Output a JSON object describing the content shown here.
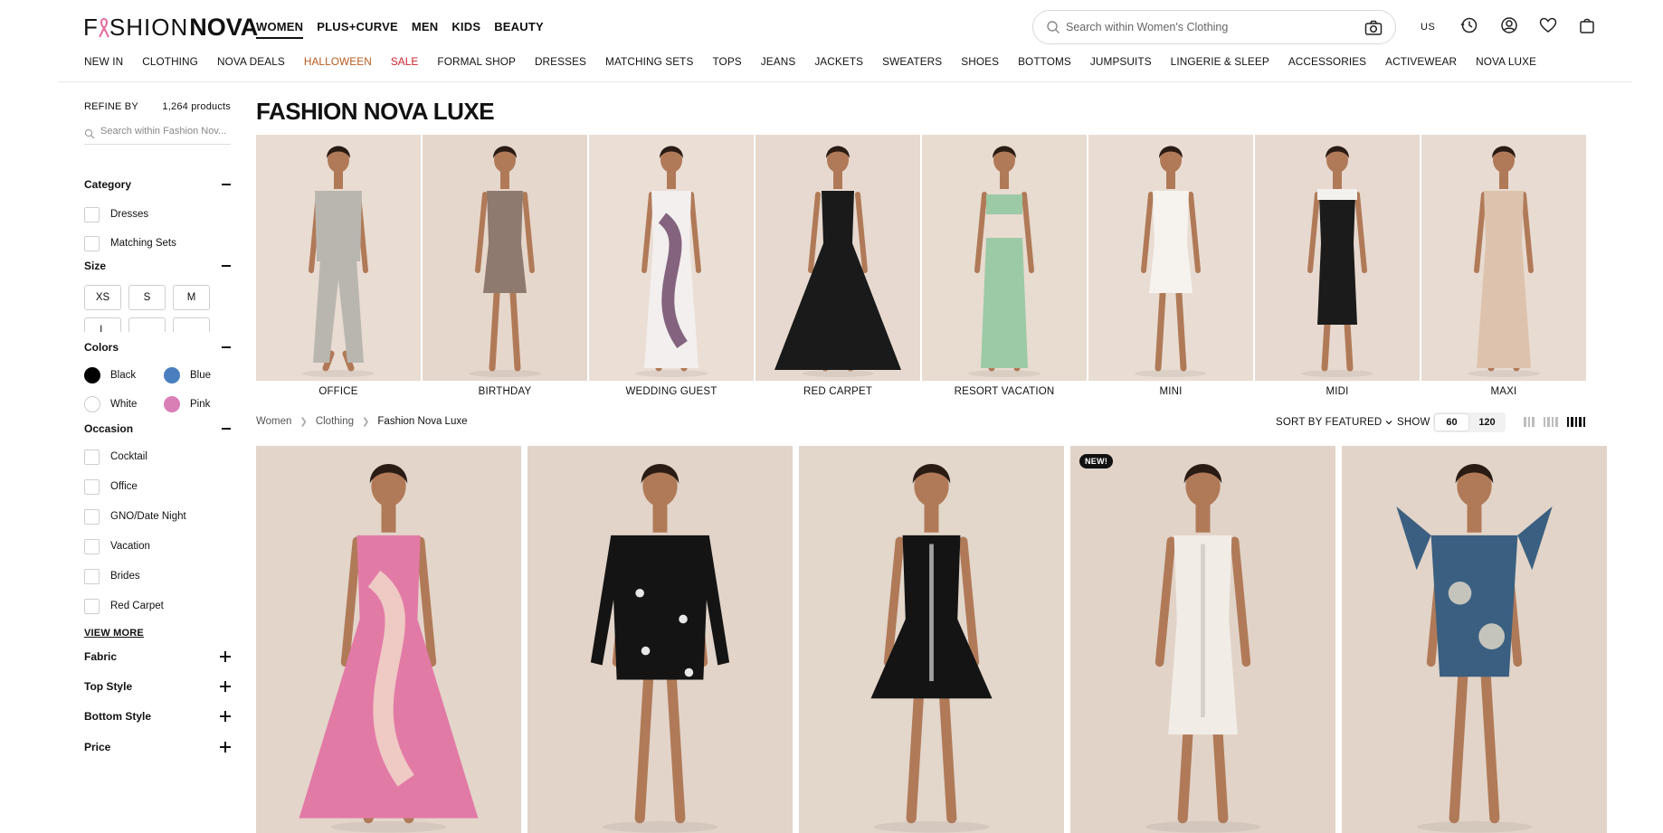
{
  "brand": {
    "name_part1": "F",
    "name_part2": "SHION",
    "name_part3": "NOVA"
  },
  "segments": [
    "WOMEN",
    "PLUS+CURVE",
    "MEN",
    "KIDS",
    "BEAUTY"
  ],
  "search": {
    "placeholder": "Search within Women's Clothing"
  },
  "region": "US",
  "nav": [
    {
      "label": "NEW IN",
      "color": "#111111"
    },
    {
      "label": "CLOTHING",
      "color": "#111111"
    },
    {
      "label": "NOVA DEALS",
      "color": "#111111"
    },
    {
      "label": "HALLOWEEN",
      "color": "#b65a1d"
    },
    {
      "label": "SALE",
      "color": "#d0222d"
    },
    {
      "label": "FORMAL SHOP",
      "color": "#111111"
    },
    {
      "label": "DRESSES",
      "color": "#111111"
    },
    {
      "label": "MATCHING SETS",
      "color": "#111111"
    },
    {
      "label": "TOPS",
      "color": "#111111"
    },
    {
      "label": "JEANS",
      "color": "#111111"
    },
    {
      "label": "JACKETS",
      "color": "#111111"
    },
    {
      "label": "SWEATERS",
      "color": "#111111"
    },
    {
      "label": "SHOES",
      "color": "#111111"
    },
    {
      "label": "BOTTOMS",
      "color": "#111111"
    },
    {
      "label": "JUMPSUITS",
      "color": "#111111"
    },
    {
      "label": "LINGERIE & SLEEP",
      "color": "#111111"
    },
    {
      "label": "ACCESSORIES",
      "color": "#111111"
    },
    {
      "label": "ACTIVEWEAR",
      "color": "#111111"
    },
    {
      "label": "NOVA LUXE",
      "color": "#111111"
    }
  ],
  "sidebar": {
    "refine_label": "REFINE BY",
    "product_count": "1,264 products",
    "search_placeholder": "Search within Fashion Nov...",
    "category": {
      "title": "Category",
      "options": [
        "Dresses",
        "Matching Sets"
      ]
    },
    "size": {
      "title": "Size",
      "options": [
        "XS",
        "S",
        "M",
        "L"
      ]
    },
    "colors": {
      "title": "Colors",
      "options": [
        {
          "label": "Black",
          "swatch": "#000000"
        },
        {
          "label": "Blue",
          "swatch": "#4a7fbf"
        },
        {
          "label": "White",
          "swatch": "#ffffff"
        },
        {
          "label": "Pink",
          "swatch": "#d97fb6"
        }
      ]
    },
    "occasion": {
      "title": "Occasion",
      "options": [
        "Cocktail",
        "Office",
        "GNO/Date Night",
        "Vacation",
        "Brides",
        "Red Carpet"
      ],
      "view_more": "VIEW MORE"
    },
    "collapsed": [
      "Fabric",
      "Top Style",
      "Bottom Style",
      "Price"
    ]
  },
  "page_title": "FASHION NOVA LUXE",
  "categories": [
    {
      "label": "OFFICE",
      "bg": "#e9dcd2",
      "outfit": "#b9b6b0",
      "style": "suit"
    },
    {
      "label": "BIRTHDAY",
      "bg": "#e6d7cc",
      "outfit": "#8f7a70",
      "style": "mini"
    },
    {
      "label": "WEDDING GUEST",
      "bg": "#eaded5",
      "outfit": "#f3efee",
      "accent": "#6e4a6a",
      "style": "gown"
    },
    {
      "label": "RED CARPET",
      "bg": "#e7d9cf",
      "outfit": "#1a1a1a",
      "style": "ballgown"
    },
    {
      "label": "RESORT VACATION",
      "bg": "#e8dbd0",
      "outfit": "#9cc9a6",
      "style": "set"
    },
    {
      "label": "MINI",
      "bg": "#e9ddd3",
      "outfit": "#f6f3ef",
      "style": "mini"
    },
    {
      "label": "MIDI",
      "bg": "#e7d9cf",
      "outfit": "#1b1b1b",
      "accent": "#f3f1ee",
      "style": "midi"
    },
    {
      "label": "MAXI",
      "bg": "#e8dbd1",
      "outfit": "#ddc3ad",
      "style": "gown"
    }
  ],
  "breadcrumb": [
    "Women",
    "Clothing",
    "Fashion Nova Luxe"
  ],
  "sort_label": "SORT BY FEATURED",
  "show_label": "SHOW",
  "show_options": [
    "60",
    "120"
  ],
  "products": [
    {
      "name": "pink-kaftan-gown",
      "bg": "#e3d5ca",
      "outfit": "#e27aa6",
      "accent": "#f1d7c8",
      "style": "kaftan",
      "badge": ""
    },
    {
      "name": "black-embellished-blazer-romper",
      "bg": "#e2d4c9",
      "outfit": "#141414",
      "accent": "#e7e7e7",
      "style": "blazer",
      "badge": ""
    },
    {
      "name": "black-halter-flare-dress",
      "bg": "#e3d6cb",
      "outfit": "#141414",
      "accent": "#dcdcdc",
      "style": "flare",
      "badge": ""
    },
    {
      "name": "white-tweed-mini-dress",
      "bg": "#e1d3c8",
      "outfit": "#f1ede6",
      "accent": "#c9c4bc",
      "style": "sheath",
      "badge": "NEW!"
    },
    {
      "name": "printed-ruffle-romper",
      "bg": "#e2d4c8",
      "outfit": "#3a5f80",
      "accent": "#e9ddcb",
      "style": "romper",
      "badge": ""
    }
  ]
}
